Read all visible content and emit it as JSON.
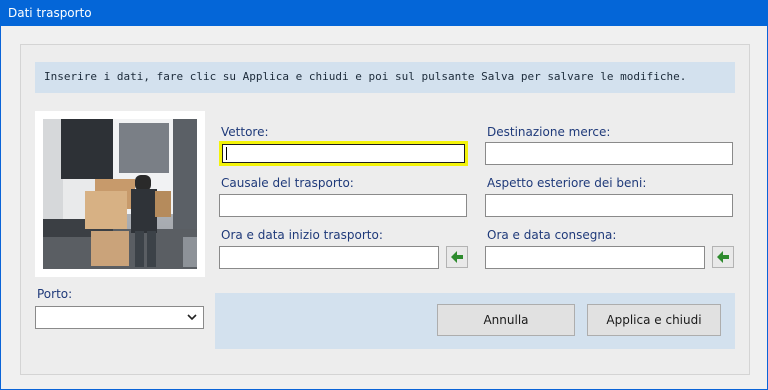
{
  "window": {
    "title": "Dati trasporto"
  },
  "banner": {
    "text": "Inserire i dati, fare clic su Applica e chiudi e poi sul pulsante Salva per salvare le modifiche."
  },
  "fields": {
    "vettore": {
      "label": "Vettore:",
      "value": ""
    },
    "destinazione": {
      "label": "Destinazione merce:",
      "value": ""
    },
    "causale": {
      "label": "Causale del trasporto:",
      "value": ""
    },
    "aspetto": {
      "label": "Aspetto esteriore dei beni:",
      "value": ""
    },
    "ora_inizio": {
      "label": "Ora e data inizio trasporto:",
      "value": ""
    },
    "ora_consegna": {
      "label": "Ora e data consegna:",
      "value": ""
    },
    "porto": {
      "label": "Porto:",
      "selected": ""
    }
  },
  "buttons": {
    "cancel": "Annulla",
    "apply": "Applica e chiudi"
  },
  "colors": {
    "titlebar": "#0466d8",
    "banner_bg": "#d3e1ee",
    "label": "#1f3a7a",
    "focus": "#f3f30a",
    "arrow": "#2e8b2e"
  },
  "icons": {
    "insert_now": "arrow-left-icon",
    "dropdown": "chevron-down-icon"
  }
}
